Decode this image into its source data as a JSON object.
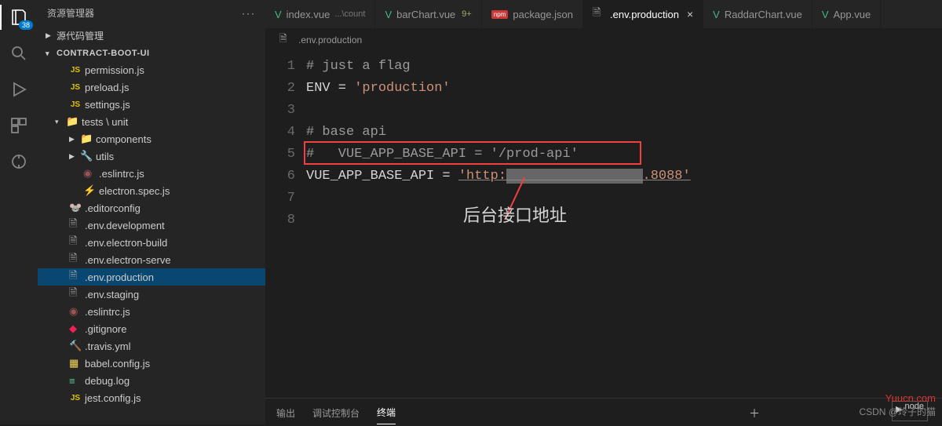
{
  "activity_badge": "38",
  "sidebar": {
    "title": "资源管理器",
    "scm": "源代码管理",
    "project": "CONTRACT-BOOT-UI"
  },
  "tree": {
    "files_top": [
      {
        "name": "permission.js",
        "icon": "js"
      },
      {
        "name": "preload.js",
        "icon": "js"
      },
      {
        "name": "settings.js",
        "icon": "js"
      }
    ],
    "folder1": "tests \\ unit",
    "sub_folders": [
      {
        "name": "components",
        "icon": "folder"
      },
      {
        "name": "utils",
        "icon": "folder-util"
      }
    ],
    "sub_files1": [
      {
        "name": ".eslintrc.js",
        "icon": "eslint"
      },
      {
        "name": "electron.spec.js",
        "icon": "elec"
      }
    ],
    "root_files": [
      {
        "name": ".editorconfig",
        "icon": "edit"
      },
      {
        "name": ".env.development",
        "icon": "file"
      },
      {
        "name": ".env.electron-build",
        "icon": "file"
      },
      {
        "name": ".env.electron-serve",
        "icon": "file"
      },
      {
        "name": ".env.production",
        "icon": "file",
        "selected": true
      },
      {
        "name": ".env.staging",
        "icon": "file"
      },
      {
        "name": ".eslintrc.js",
        "icon": "eslint"
      },
      {
        "name": ".gitignore",
        "icon": "git"
      },
      {
        "name": ".travis.yml",
        "icon": "travis"
      },
      {
        "name": "babel.config.js",
        "icon": "babel"
      },
      {
        "name": "debug.log",
        "icon": "log"
      },
      {
        "name": "jest.config.js",
        "icon": "js"
      }
    ]
  },
  "tabs": [
    {
      "icon": "vue",
      "label": "index.vue",
      "sub": "...\\count"
    },
    {
      "icon": "vue",
      "label": "barChart.vue",
      "dirty": "9+"
    },
    {
      "icon": "npm",
      "label": "package.json"
    },
    {
      "icon": "file",
      "label": ".env.production",
      "active": true,
      "close": true
    },
    {
      "icon": "vue",
      "label": "RaddarChart.vue"
    },
    {
      "icon": "vue",
      "label": "App.vue"
    }
  ],
  "pathbar": ".env.production",
  "code": {
    "lines": [
      "1",
      "2",
      "3",
      "4",
      "5",
      "6",
      "7",
      "8"
    ],
    "l1": "# just a flag",
    "l2a": "ENV = ",
    "l2b": "'production'",
    "l4": "# base api",
    "l5": "#   VUE_APP_BASE_API = '/prod-api'",
    "l6a": "VUE_APP_BASE_API = ",
    "l6b": "'http:",
    "l6c": ".8088'"
  },
  "annotation": "后台接口地址",
  "panel": {
    "out": "输出",
    "dbg": "调试控制台",
    "term": "终端"
  },
  "node": "node",
  "watermark": "Yuucn.com",
  "csdn": "CSDN @玲子的猫"
}
